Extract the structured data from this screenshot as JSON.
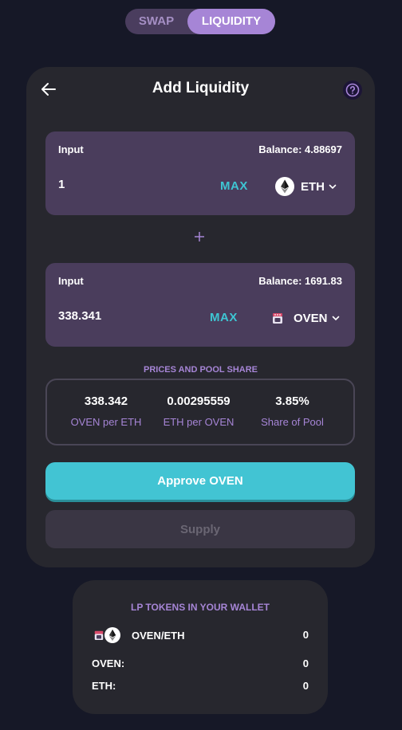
{
  "toggle": {
    "swap_label": "SWAP",
    "liquidity_label": "LIQUIDITY"
  },
  "header": {
    "title": "Add Liquidity",
    "back_icon": "arrow-left-icon",
    "help_icon": "question-circle-icon"
  },
  "input_a": {
    "label": "Input",
    "balance": "Balance: 4.88697",
    "amount": "1",
    "max_label": "MAX",
    "token": "ETH"
  },
  "input_b": {
    "label": "Input",
    "balance": "Balance: 1691.83",
    "amount": "338.341",
    "max_label": "MAX",
    "token": "OVEN"
  },
  "prices": {
    "title": "PRICES AND POOL SHARE",
    "items": [
      {
        "value": "338.342",
        "label": "OVEN per ETH"
      },
      {
        "value": "0.00295559",
        "label": "ETH per OVEN"
      },
      {
        "value": "3.85%",
        "label": "Share of Pool"
      }
    ]
  },
  "actions": {
    "approve_label": "Approve OVEN",
    "supply_label": "Supply"
  },
  "lp_wallet": {
    "title": "LP TOKENS IN YOUR WALLET",
    "pair_name": "OVEN/ETH",
    "pair_value": "0",
    "oven_label": "OVEN:",
    "oven_value": "0",
    "eth_label": "ETH:",
    "eth_value": "0"
  },
  "colors": {
    "accent_purple": "#a685d6",
    "accent_teal": "#42c4d3",
    "card_bg": "#27272e",
    "input_bg": "#4a3d5c"
  }
}
